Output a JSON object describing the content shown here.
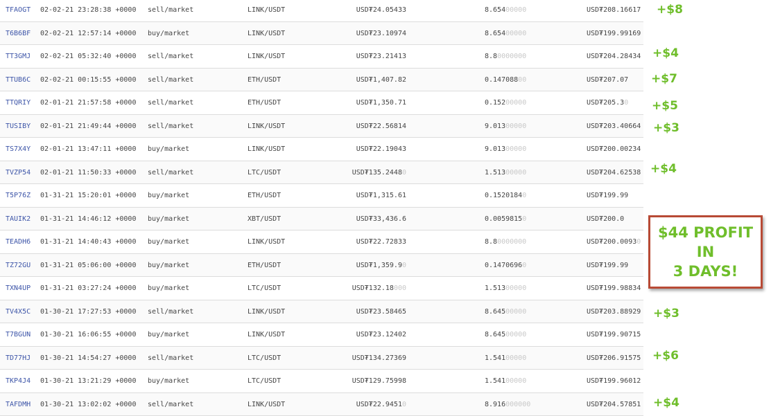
{
  "trades": [
    {
      "id": "TFAOGT",
      "date": "02-02-21 23:28:38 +0000",
      "type": "sell/market",
      "pair": "LINK/USDT",
      "price": "USD₮24.05433",
      "price_faint": "",
      "amount": "8.654",
      "amount_faint": "00000",
      "total": "USD₮208.16617",
      "total_faint": ""
    },
    {
      "id": "T6B6BF",
      "date": "02-02-21 12:57:14 +0000",
      "type": "buy/market",
      "pair": "LINK/USDT",
      "price": "USD₮23.10974",
      "price_faint": "",
      "amount": "8.654",
      "amount_faint": "00000",
      "total": "USD₮199.99169",
      "total_faint": ""
    },
    {
      "id": "TT3GMJ",
      "date": "02-02-21 05:32:40 +0000",
      "type": "sell/market",
      "pair": "LINK/USDT",
      "price": "USD₮23.21413",
      "price_faint": "",
      "amount": "8.8",
      "amount_faint": "0000000",
      "total": "USD₮204.28434",
      "total_faint": ""
    },
    {
      "id": "TTUB6C",
      "date": "02-02-21 00:15:55 +0000",
      "type": "sell/market",
      "pair": "ETH/USDT",
      "price": "USD₮1,407.82",
      "price_faint": "",
      "amount": "0.147088",
      "amount_faint": "00",
      "total": "USD₮207.07",
      "total_faint": ""
    },
    {
      "id": "TTQRIY",
      "date": "02-01-21 21:57:58 +0000",
      "type": "sell/market",
      "pair": "ETH/USDT",
      "price": "USD₮1,350.71",
      "price_faint": "",
      "amount": "0.152",
      "amount_faint": "00000",
      "total": "USD₮205.3",
      "total_faint": "0"
    },
    {
      "id": "TUSIBY",
      "date": "02-01-21 21:49:44 +0000",
      "type": "sell/market",
      "pair": "LINK/USDT",
      "price": "USD₮22.56814",
      "price_faint": "",
      "amount": "9.013",
      "amount_faint": "00000",
      "total": "USD₮203.40664",
      "total_faint": ""
    },
    {
      "id": "TS7X4Y",
      "date": "02-01-21 13:47:11 +0000",
      "type": "buy/market",
      "pair": "LINK/USDT",
      "price": "USD₮22.19043",
      "price_faint": "",
      "amount": "9.013",
      "amount_faint": "00000",
      "total": "USD₮200.00234",
      "total_faint": ""
    },
    {
      "id": "TVZP54",
      "date": "02-01-21 11:50:33 +0000",
      "type": "sell/market",
      "pair": "LTC/USDT",
      "price": "USD₮135.2448",
      "price_faint": "0",
      "amount": "1.513",
      "amount_faint": "00000",
      "total": "USD₮204.62538",
      "total_faint": ""
    },
    {
      "id": "T5P76Z",
      "date": "01-31-21 15:20:01 +0000",
      "type": "buy/market",
      "pair": "ETH/USDT",
      "price": "USD₮1,315.61",
      "price_faint": "",
      "amount": "0.1520184",
      "amount_faint": "0",
      "total": "USD₮199.99",
      "total_faint": ""
    },
    {
      "id": "TAUIK2",
      "date": "01-31-21 14:46:12 +0000",
      "type": "buy/market",
      "pair": "XBT/USDT",
      "price": "USD₮33,436.6",
      "price_faint": "",
      "amount": "0.0059815",
      "amount_faint": "0",
      "total": "USD₮200.0",
      "total_faint": ""
    },
    {
      "id": "TEADH6",
      "date": "01-31-21 14:40:43 +0000",
      "type": "buy/market",
      "pair": "LINK/USDT",
      "price": "USD₮22.72833",
      "price_faint": "",
      "amount": "8.8",
      "amount_faint": "0000000",
      "total": "USD₮200.0093",
      "total_faint": "0"
    },
    {
      "id": "TZ72GU",
      "date": "01-31-21 05:06:00 +0000",
      "type": "buy/market",
      "pair": "ETH/USDT",
      "price": "USD₮1,359.9",
      "price_faint": "0",
      "amount": "0.1470696",
      "amount_faint": "0",
      "total": "USD₮199.99",
      "total_faint": ""
    },
    {
      "id": "TXN4UP",
      "date": "01-31-21 03:27:24 +0000",
      "type": "buy/market",
      "pair": "LTC/USDT",
      "price": "USD₮132.18",
      "price_faint": "000",
      "amount": "1.513",
      "amount_faint": "00000",
      "total": "USD₮199.98834",
      "total_faint": ""
    },
    {
      "id": "TV4X5C",
      "date": "01-30-21 17:27:53 +0000",
      "type": "sell/market",
      "pair": "LINK/USDT",
      "price": "USD₮23.58465",
      "price_faint": "",
      "amount": "8.645",
      "amount_faint": "00000",
      "total": "USD₮203.88929",
      "total_faint": ""
    },
    {
      "id": "T7BGUN",
      "date": "01-30-21 16:06:55 +0000",
      "type": "buy/market",
      "pair": "LINK/USDT",
      "price": "USD₮23.12402",
      "price_faint": "",
      "amount": "8.645",
      "amount_faint": "00000",
      "total": "USD₮199.90715",
      "total_faint": ""
    },
    {
      "id": "TD77HJ",
      "date": "01-30-21 14:54:27 +0000",
      "type": "sell/market",
      "pair": "LTC/USDT",
      "price": "USD₮134.27369",
      "price_faint": "",
      "amount": "1.541",
      "amount_faint": "00000",
      "total": "USD₮206.91575",
      "total_faint": ""
    },
    {
      "id": "TKP4J4",
      "date": "01-30-21 13:21:29 +0000",
      "type": "buy/market",
      "pair": "LTC/USDT",
      "price": "USD₮129.75998",
      "price_faint": "",
      "amount": "1.541",
      "amount_faint": "00000",
      "total": "USD₮199.96012",
      "total_faint": ""
    },
    {
      "id": "TAFDMH",
      "date": "01-30-21 13:02:02 +0000",
      "type": "sell/market",
      "pair": "LINK/USDT",
      "price": "USD₮22.9451",
      "price_faint": "0",
      "amount": "8.916",
      "amount_faint": "000000",
      "total": "USD₮204.57851",
      "total_faint": ""
    }
  ],
  "profits": [
    "+$8",
    "+$4",
    "+$7",
    "+$5",
    "+$3",
    "+$4",
    "+$3",
    "+$6",
    "+$4"
  ],
  "callout": {
    "line1": "$44 PROFIT IN",
    "line2": "3 DAYS!"
  },
  "colors": {
    "profit": "#6fbe2b",
    "callout_border": "#b84a35",
    "id_link": "#3d55a8"
  }
}
